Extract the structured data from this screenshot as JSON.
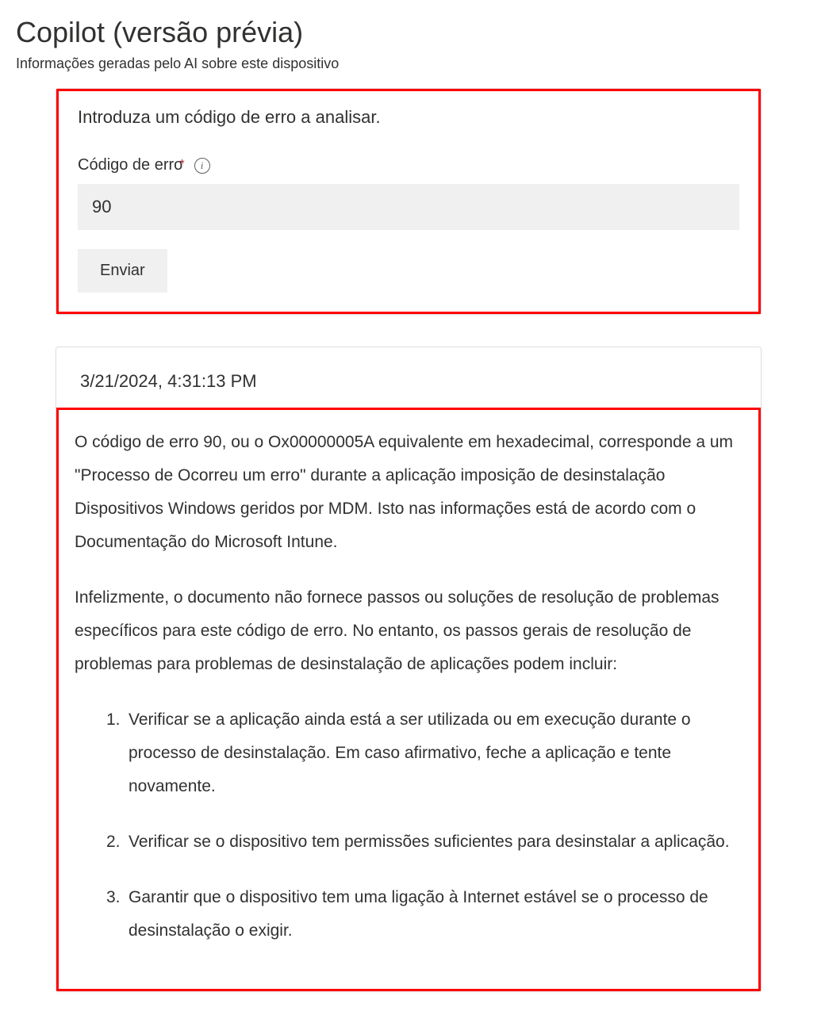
{
  "header": {
    "title": "Copilot (versão prévia)",
    "subtitle": "Informações geradas pelo AI sobre este dispositivo"
  },
  "input_card": {
    "prompt": "Introduza um código de erro a analisar.",
    "field_label": "Código de erro",
    "info_char": "i",
    "value": "90",
    "submit_label": "Enviar"
  },
  "response": {
    "timestamp": "3/21/2024, 4:31:13 PM",
    "para1": "O código de erro 90, ou o Ox00000005A equivalente em hexadecimal, corresponde a um \"Processo de Ocorreu um erro\" durante a aplicação imposição de desinstalação Dispositivos Windows geridos por MDM. Isto nas informações está de acordo com o Documentação do Microsoft Intune.",
    "para2": "Infelizmente, o documento não fornece passos ou soluções de resolução de problemas específicos para este código de erro. No entanto, os passos gerais de resolução de problemas para problemas de desinstalação de aplicações podem incluir:",
    "steps": [
      "Verificar se a aplicação ainda está a ser utilizada ou em execução durante o processo de desinstalação. Em caso afirmativo, feche a aplicação e tente novamente.",
      "Verificar se o dispositivo tem permissões suficientes para desinstalar a aplicação.",
      "Garantir que o dispositivo tem uma ligação à Internet estável se o processo de desinstalação o exigir."
    ]
  }
}
